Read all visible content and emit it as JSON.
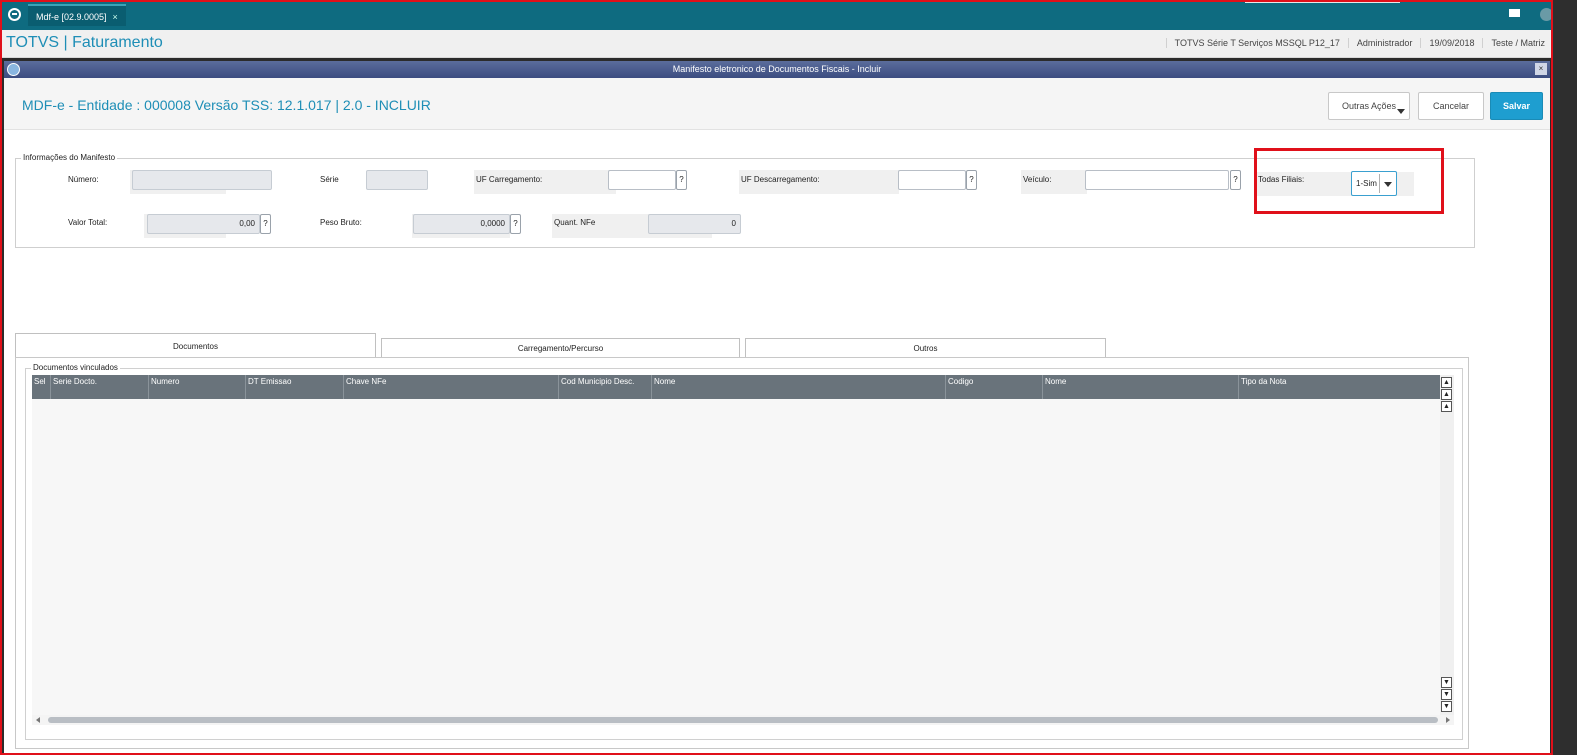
{
  "topbar": {
    "tab_label": "Mdf-e [02.9.0005]",
    "tab_close": "×"
  },
  "header": {
    "brand": "TOTVS | Faturamento",
    "env": "TOTVS Série T Serviços MSSQL P12_17",
    "user": "Administrador",
    "date": "19/09/2018",
    "company": "Teste / Matriz"
  },
  "dialog": {
    "title": "Manifesto eletronico de Documentos Fiscais - Incluir",
    "close": "×"
  },
  "page": {
    "title": "MDF-e - Entidade : 000008 Versão TSS: 12.1.017 | 2.0 - INCLUIR"
  },
  "actions": {
    "outras": "Outras Ações",
    "cancelar": "Cancelar",
    "salvar": "Salvar"
  },
  "manifesto": {
    "legend": "Informações do Manifesto",
    "numero_label": "Número:",
    "numero_value": "",
    "serie_label": "Série",
    "serie_value": "",
    "uf_carreg_label": "UF Carregamento:",
    "uf_carreg_value": "",
    "uf_descarreg_label": "UF Descarregamento:",
    "uf_descarreg_value": "",
    "veiculo_label": "Veículo:",
    "veiculo_value": "",
    "todas_filiais_label": "Todas Filiais:",
    "todas_filiais_value": "1-Sim",
    "valor_total_label": "Valor Total:",
    "valor_total_value": "0,00",
    "peso_bruto_label": "Peso Bruto:",
    "peso_bruto_value": "0,0000",
    "quant_nfe_label": "Quant. NFe",
    "quant_nfe_value": "0",
    "lookup": "?"
  },
  "tabs": [
    "Documentos",
    "Carregamento/Percurso",
    "Outros"
  ],
  "documentos": {
    "legend": "Documentos vinculados",
    "columns": [
      "Sel",
      "Serie Docto.",
      "Numero",
      "DT Emissao",
      "Chave NFe",
      "Cod Municipio Desc.",
      "Nome",
      "Codigo",
      "Nome",
      "Tipo da Nota"
    ]
  }
}
